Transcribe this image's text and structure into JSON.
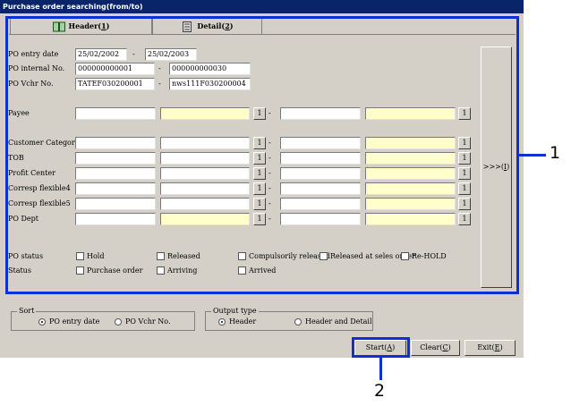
{
  "window": {
    "title": "Purchase order searching(from/to)"
  },
  "tabs": [
    {
      "label": "Header(",
      "key": "1",
      "suffix": ")"
    },
    {
      "label": "Detail(",
      "key": "2",
      "suffix": ")"
    }
  ],
  "fields": {
    "po_entry_date": {
      "label": "PO entry date",
      "from": "25/02/2002",
      "to": "25/02/2003"
    },
    "po_internal_no": {
      "label": "PO internal No.",
      "from": "000000000001",
      "to": "000000000030"
    },
    "po_vchr_no": {
      "label": "PO Vchr No.",
      "from": "TATEF030200001",
      "to": "nws111F030200004"
    }
  },
  "range_rows": [
    {
      "id": "payee",
      "label": "Payee"
    },
    {
      "id": "customer-category",
      "label": "Customer Category"
    },
    {
      "id": "tob",
      "label": "TOB"
    },
    {
      "id": "profit-center",
      "label": "Profit Center"
    },
    {
      "id": "corresp-flexible4",
      "label": "Corresp flexible4"
    },
    {
      "id": "corresp-flexible5",
      "label": "Corresp flexible5"
    },
    {
      "id": "po-dept",
      "label": "PO Dept"
    }
  ],
  "search_button": {
    "label": "1"
  },
  "dash": "-",
  "po_status": {
    "label": "PO status",
    "options": [
      "Hold",
      "Released",
      "Compulsorily released",
      "Released at seles order",
      "Re-HOLD"
    ]
  },
  "status": {
    "label": "Status",
    "options": [
      "Purchase order",
      "Arriving",
      "Arrived"
    ]
  },
  "side_button": {
    "label": ">>>(",
    "key": "I",
    "suffix": ")"
  },
  "sort": {
    "label": "Sort",
    "options": [
      "PO entry date",
      "PO Vchr No."
    ],
    "selected": "PO entry date"
  },
  "output_type": {
    "label": "Output type",
    "options": [
      "Header",
      "Header and Detail"
    ],
    "selected": "Header"
  },
  "buttons": {
    "start": {
      "label": "Start(",
      "key": "A",
      "suffix": ")"
    },
    "clear": {
      "label": "Clear(",
      "key": "C",
      "suffix": ")"
    },
    "exit": {
      "label": "Exit(",
      "key": "E",
      "suffix": ")"
    }
  },
  "callouts": {
    "one": "1",
    "two": "2"
  },
  "colors": {
    "titlebar": "#0a246a",
    "highlight": "#0b2fd8",
    "yellow_field": "#ffffcc",
    "window_bg": "#d4d0c8"
  }
}
